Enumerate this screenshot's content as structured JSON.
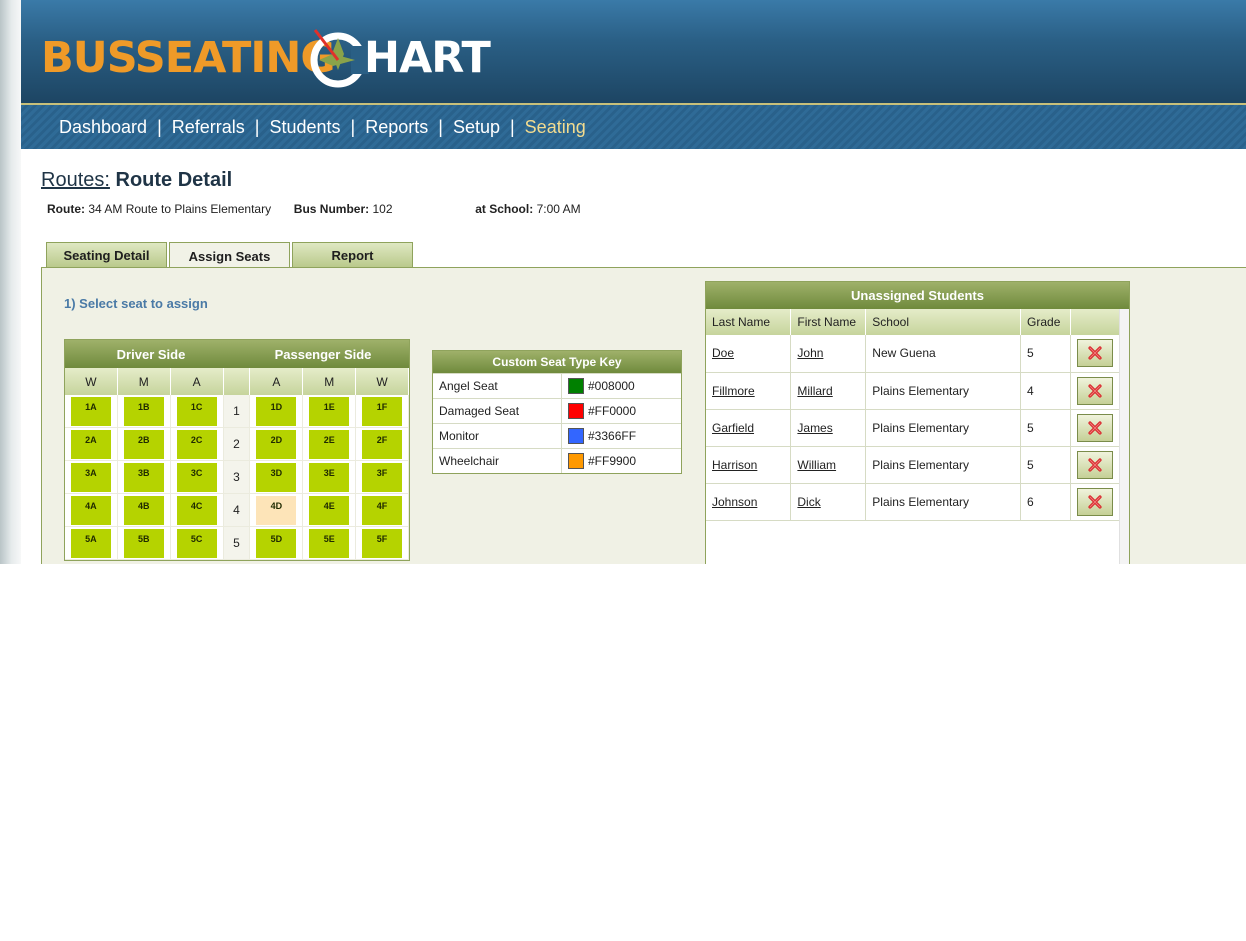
{
  "logo": {
    "part1": "BUSSEATING",
    "part2": "HART"
  },
  "nav": [
    {
      "label": "Dashboard"
    },
    {
      "label": "Referrals"
    },
    {
      "label": "Students"
    },
    {
      "label": "Reports"
    },
    {
      "label": "Setup"
    },
    {
      "label": "Seating",
      "active": true
    }
  ],
  "nav_separator": "|",
  "breadcrumb": {
    "link": "Routes:",
    "current": "Route Detail"
  },
  "route_info": {
    "route_label": "Route:",
    "route_value": "34 AM Route to Plains Elementary",
    "bus_label": "Bus Number:",
    "bus_value": "102",
    "school_label": "at School:",
    "school_value": "7:00 AM"
  },
  "tabs": [
    "Seating Detail",
    "Assign Seats",
    "Report"
  ],
  "active_tab": "Assign Seats",
  "step1": "1) Select seat to assign",
  "seat_map": {
    "driver_side": "Driver Side",
    "passenger_side": "Passenger Side",
    "columns": [
      "W",
      "M",
      "A",
      "",
      "A",
      "M",
      "W"
    ],
    "rows": [
      {
        "num": "1",
        "seats": [
          "1A",
          "1B",
          "1C",
          "1D",
          "1E",
          "1F"
        ],
        "empty": []
      },
      {
        "num": "2",
        "seats": [
          "2A",
          "2B",
          "2C",
          "2D",
          "2E",
          "2F"
        ],
        "empty": []
      },
      {
        "num": "3",
        "seats": [
          "3A",
          "3B",
          "3C",
          "3D",
          "3E",
          "3F"
        ],
        "empty": []
      },
      {
        "num": "4",
        "seats": [
          "4A",
          "4B",
          "4C",
          "4D",
          "4E",
          "4F"
        ],
        "empty": [
          "4D"
        ]
      },
      {
        "num": "5",
        "seats": [
          "5A",
          "5B",
          "5C",
          "5D",
          "5E",
          "5F"
        ],
        "empty": []
      }
    ]
  },
  "seat_key": {
    "title": "Custom Seat Type Key",
    "items": [
      {
        "name": "Angel Seat",
        "color": "#008000"
      },
      {
        "name": "Damaged Seat",
        "color": "#FF0000"
      },
      {
        "name": "Monitor",
        "color": "#3366FF"
      },
      {
        "name": "Wheelchair",
        "color": "#FF9900"
      }
    ]
  },
  "unassigned": {
    "title": "Unassigned Students",
    "headers": [
      "Last Name",
      "First Name",
      "School",
      "Grade"
    ],
    "rows": [
      {
        "last": "Doe",
        "first": "John",
        "school": "New Guena",
        "grade": "5"
      },
      {
        "last": "Fillmore",
        "first": "Millard",
        "school": "Plains Elementary",
        "grade": "4"
      },
      {
        "last": "Garfield",
        "first": "James",
        "school": "Plains Elementary",
        "grade": "5"
      },
      {
        "last": "Harrison",
        "first": "William",
        "school": "Plains Elementary",
        "grade": "5"
      },
      {
        "last": "Johnson",
        "first": "Dick",
        "school": "Plains Elementary",
        "grade": "6"
      }
    ]
  },
  "icons": {
    "remove": "red-x-icon",
    "logo_compass": "compass-icon"
  }
}
